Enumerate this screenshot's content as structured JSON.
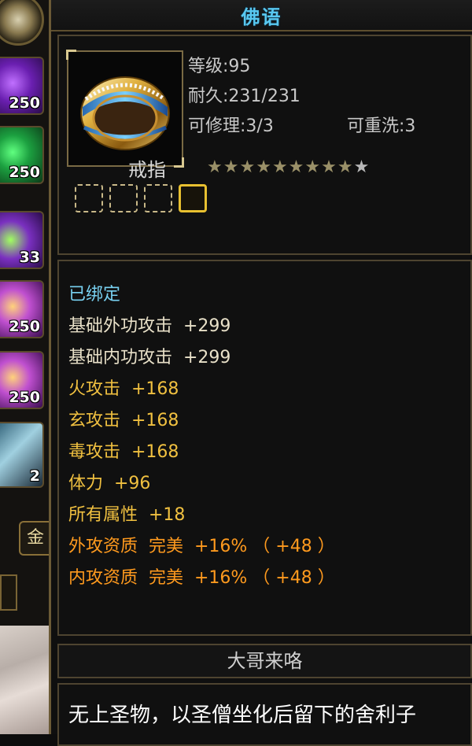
{
  "inventory": {
    "slots": [
      {
        "icon": "purple-flame-icon",
        "count": "250"
      },
      {
        "icon": "green-orb-icon",
        "count": "250"
      },
      {
        "icon": "green-purple-flame-icon",
        "count": "33"
      },
      {
        "icon": "golden-charm-icon",
        "count": "250"
      },
      {
        "icon": "golden-charm-icon",
        "count": "250"
      },
      {
        "icon": "feather-icon",
        "count": "2"
      }
    ],
    "gold_button_label": "金"
  },
  "tooltip": {
    "item_name": "佛语",
    "level_line": "等级:95",
    "durability_line": "耐久:231/231",
    "repair_line": "可修理:3/3",
    "rewash_line": "可重洗:3",
    "item_type": "戒指",
    "stars_filled": 9,
    "stars_total": 10,
    "sockets_total": 4,
    "sockets_lit": 1,
    "bound_status": "已绑定",
    "base_attributes": [
      "基础外功攻击  +299",
      "基础内功攻击  +299"
    ],
    "extra_attributes": [
      "火攻击  +168",
      "玄攻击  +168",
      "毒攻击  +168",
      "体力  +96",
      "所有属性  +18"
    ],
    "quality_attributes": [
      "外攻资质  完美  +16% （ +48 ）",
      "内攻资质  完美  +16% （ +48 ）"
    ],
    "source": "大哥来咯",
    "description": "无上圣物，以圣僧坐化后留下的舍利子"
  },
  "colors": {
    "item_name": "#58c8f0",
    "bound": "#78d0f0",
    "extra_attr": "#f0c040",
    "quality_attr": "#ff9a1e",
    "border": "#6b5a36"
  }
}
